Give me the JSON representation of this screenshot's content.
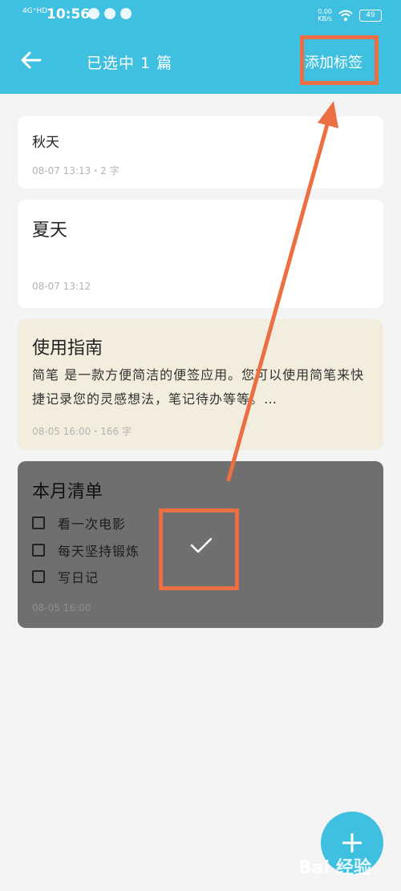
{
  "status": {
    "network": "4G⁺HD",
    "time": "10:56",
    "speed_value": "0.00",
    "speed_unit": "KB/s",
    "battery": "49"
  },
  "header": {
    "title": "已选中 1 篇",
    "add_tag": "添加标签"
  },
  "notes": [
    {
      "title": "秋天",
      "meta": "08-07 13:13・2 字"
    },
    {
      "title": "夏天",
      "meta": "08-07 13:12"
    },
    {
      "title": "使用指南",
      "body": "简笔 是一款方便简洁的便签应用。您可以使用简笔来快捷记录您的灵感想法，笔记待办等等。…",
      "meta": "08-05 16:00・166 字"
    },
    {
      "title": "本月清单",
      "items": [
        "看一次电影",
        "每天坚持锻炼",
        "写日记"
      ],
      "meta": "08-05 16:00",
      "selected": true
    }
  ],
  "watermark": "Bai 经验",
  "colors": {
    "header": "#3fc0e0",
    "highlight": "#ec6f43",
    "selected_card": "#6f6f6f",
    "guide_card": "#f2eddd"
  }
}
